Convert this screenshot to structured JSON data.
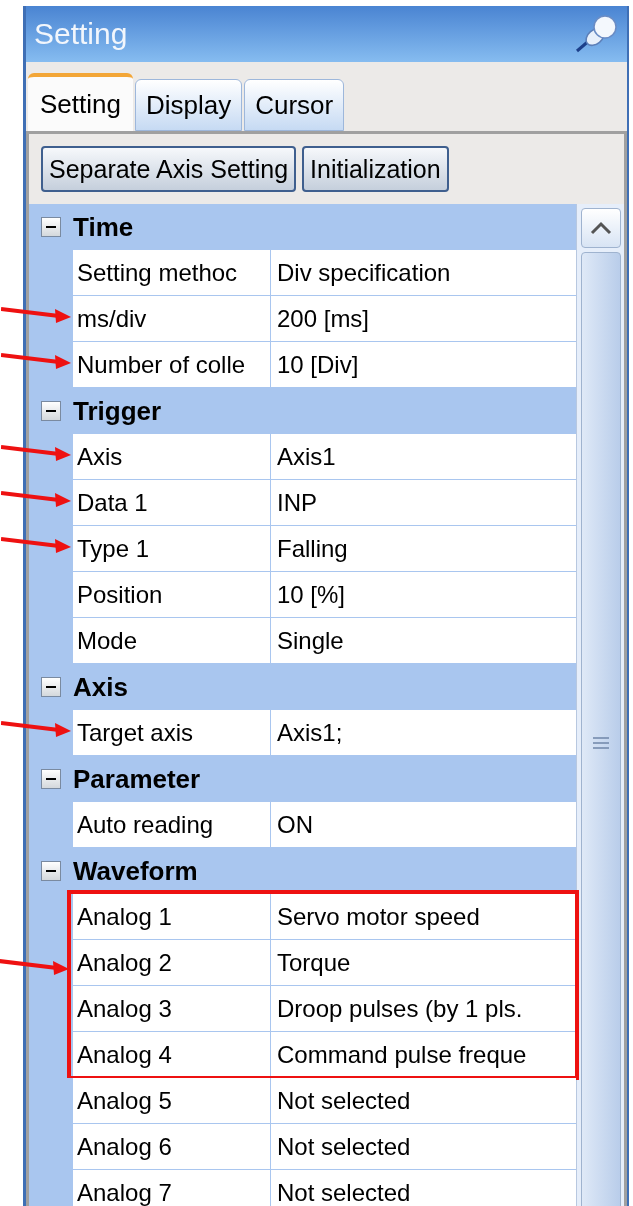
{
  "window": {
    "title": "Setting"
  },
  "tabs": [
    {
      "label": "Setting",
      "selected": true
    },
    {
      "label": "Display",
      "selected": false
    },
    {
      "label": "Cursor",
      "selected": false
    }
  ],
  "buttons": [
    "Separate Axis Setting",
    "Initialization"
  ],
  "sections": [
    {
      "title": "Time",
      "expanded": true,
      "rows": [
        {
          "label": "Setting methoc",
          "value": "Div specification",
          "arrow": false,
          "boxed": false
        },
        {
          "label": "ms/div",
          "value": "200 [ms]",
          "arrow": true,
          "boxed": false
        },
        {
          "label": "Number of colle",
          "value": "10 [Div]",
          "arrow": true,
          "boxed": false
        }
      ]
    },
    {
      "title": "Trigger",
      "expanded": true,
      "rows": [
        {
          "label": "Axis",
          "value": "Axis1",
          "arrow": true,
          "boxed": false
        },
        {
          "label": "Data 1",
          "value": "INP",
          "arrow": true,
          "boxed": false
        },
        {
          "label": "Type 1",
          "value": "Falling",
          "arrow": true,
          "boxed": false
        },
        {
          "label": "Position",
          "value": "10 [%]",
          "arrow": false,
          "boxed": false
        },
        {
          "label": "Mode",
          "value": "Single",
          "arrow": false,
          "boxed": false
        }
      ]
    },
    {
      "title": "Axis",
      "expanded": true,
      "rows": [
        {
          "label": "Target axis",
          "value": "Axis1;",
          "arrow": true,
          "boxed": false
        }
      ]
    },
    {
      "title": "Parameter",
      "expanded": true,
      "rows": [
        {
          "label": "Auto reading",
          "value": "ON",
          "arrow": false,
          "boxed": false
        }
      ]
    },
    {
      "title": "Waveform",
      "expanded": true,
      "box_arrow": true,
      "rows": [
        {
          "label": "Analog 1",
          "value": "Servo motor speed",
          "arrow": false,
          "boxed": true
        },
        {
          "label": "Analog 2",
          "value": "Torque",
          "arrow": false,
          "boxed": true
        },
        {
          "label": "Analog 3",
          "value": "Droop pulses (by 1 pls.",
          "arrow": false,
          "boxed": true
        },
        {
          "label": "Analog 4",
          "value": "Command pulse freque",
          "arrow": false,
          "boxed": true
        },
        {
          "label": "Analog 5",
          "value": "Not selected",
          "arrow": false,
          "boxed": false
        },
        {
          "label": "Analog 6",
          "value": "Not selected",
          "arrow": false,
          "boxed": false
        },
        {
          "label": "Analog 7",
          "value": "Not selected",
          "arrow": false,
          "boxed": false
        }
      ]
    }
  ]
}
